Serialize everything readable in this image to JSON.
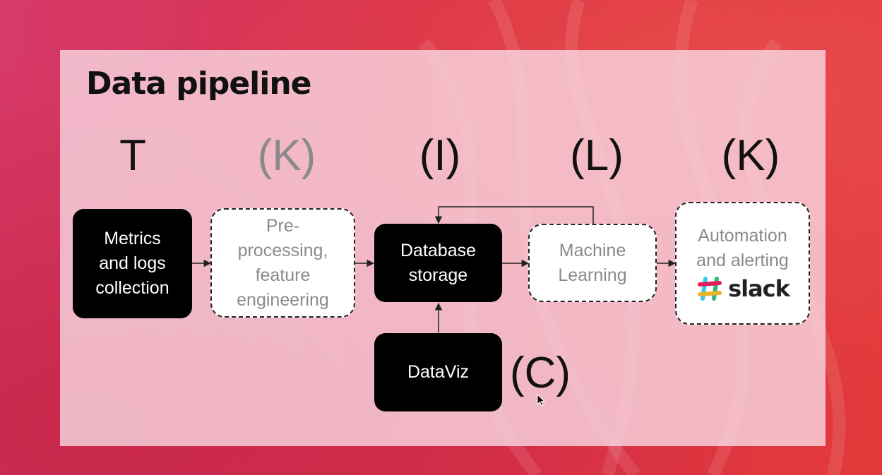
{
  "title": "Data pipeline",
  "stages": [
    {
      "letter": "T"
    },
    {
      "letter": "(K)"
    },
    {
      "letter": "(I)"
    },
    {
      "letter": "(L)"
    },
    {
      "letter": "(K)"
    }
  ],
  "nodes": {
    "metrics": {
      "label": "Metrics\nand logs\ncollection"
    },
    "preprocessing": {
      "label": "Pre-\nprocessing,\nfeature\nengineering"
    },
    "database": {
      "label": "Database\nstorage"
    },
    "ml": {
      "label": "Machine\nLearning"
    },
    "automation": {
      "label": "Automation\nand alerting"
    },
    "dataviz": {
      "label": "DataViz"
    }
  },
  "slack_text": "slack",
  "dataviz_letter": "(C)",
  "colors": {
    "solid_node": "#000000",
    "dashed_node_text": "#8a8a8a",
    "slide_panel": "#f8d6e0",
    "background": "#d8304a"
  },
  "icons": {
    "slack": "slack-icon",
    "cursor": "mouse-cursor-icon"
  }
}
